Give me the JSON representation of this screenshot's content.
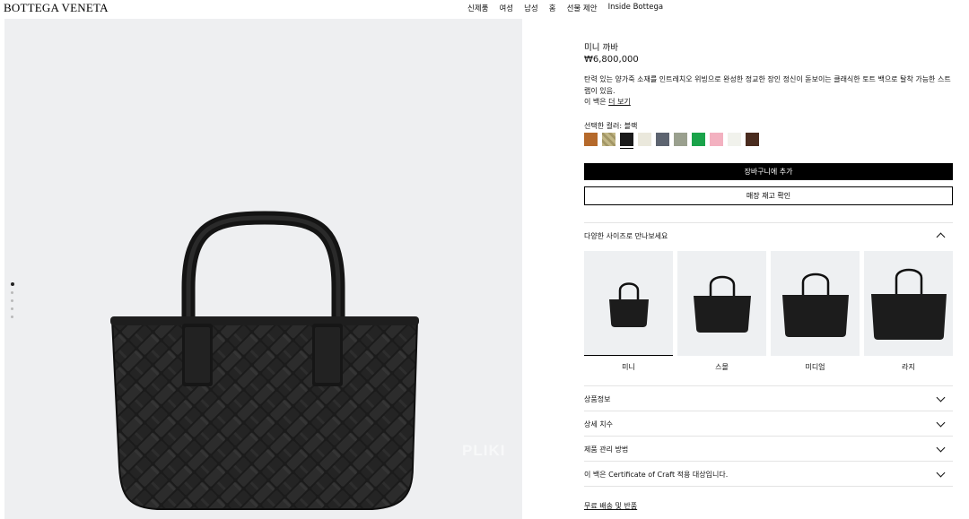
{
  "header": {
    "logo": "BOTTEGA VENETA",
    "nav": [
      "신제품",
      "여성",
      "남성",
      "홈",
      "선물 제안",
      "Inside Bottega"
    ]
  },
  "gallery": {
    "watermark": "PLIKI",
    "slides": 5,
    "active_slide": 1
  },
  "product": {
    "name": "미니 까바",
    "price": "₩6,800,000",
    "description": "탄력 있는 양가죽 소재를 인트레치오 위빙으로 완성한 정교한 장인 정신이 돋보이는 클래식한 토트 백으로 탈착 가능한 스트랩이 있음.",
    "pouch_text": "이 백은",
    "more_link": "더 보기",
    "color_label": "선택한 컬러: 블랙",
    "swatches": [
      {
        "name": "caramel",
        "color": "#b5692b"
      },
      {
        "name": "olive-woven",
        "color": "#b8ad7a"
      },
      {
        "name": "black",
        "color": "#1a1a1a",
        "selected": true
      },
      {
        "name": "cream",
        "color": "#eae8dc"
      },
      {
        "name": "slate",
        "color": "#5d6470"
      },
      {
        "name": "sage",
        "color": "#9aa08e"
      },
      {
        "name": "green",
        "color": "#1aa34a"
      },
      {
        "name": "pink",
        "color": "#f3b1c0"
      },
      {
        "name": "white",
        "color": "#f1f2ec"
      },
      {
        "name": "brown",
        "color": "#4a2c1f"
      }
    ],
    "add_to_cart": "장바구니에 추가",
    "check_stock": "매장 재고 확인"
  },
  "sizes": {
    "title": "다양한 사이즈로 만나보세요",
    "options": [
      {
        "label": "미니",
        "selected": true
      },
      {
        "label": "스몰"
      },
      {
        "label": "미디엄"
      },
      {
        "label": "라지"
      }
    ]
  },
  "accordions": [
    "상품정보",
    "상세 치수",
    "제품 관리 방법",
    "이 백은 Certificate of Craft 적용 대상입니다."
  ],
  "shipping_link": "무료 배송 및 반품"
}
